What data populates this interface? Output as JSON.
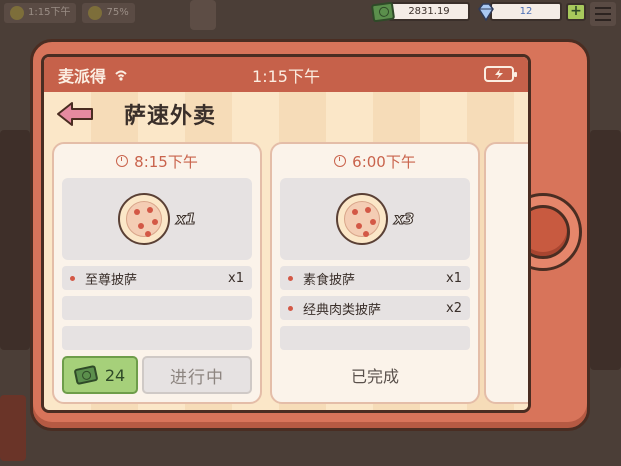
{
  "hud": {
    "cash": "2831.19",
    "gems": "12",
    "plus_label": "+",
    "bg_chip_1": "1:15下午",
    "bg_chip_2": "75%"
  },
  "status_bar": {
    "carrier": "麦派得",
    "time": "1:15下午"
  },
  "app": {
    "title": "萨速外卖"
  },
  "orders": [
    {
      "time": "8:15下午",
      "quantity": "x1",
      "items": [
        {
          "name": "至尊披萨",
          "qty": "x1"
        }
      ],
      "payment": "24",
      "status": "进行中"
    },
    {
      "time": "6:00下午",
      "quantity": "x3",
      "items": [
        {
          "name": "素食披萨",
          "qty": "x1"
        },
        {
          "name": "经典肉类披萨",
          "qty": "x2"
        }
      ],
      "status": "已完成"
    }
  ],
  "colors": {
    "device": "#d8745a",
    "status_bar": "#c6614a",
    "accent": "#c9634c",
    "pay_green": "#a6d07a"
  }
}
